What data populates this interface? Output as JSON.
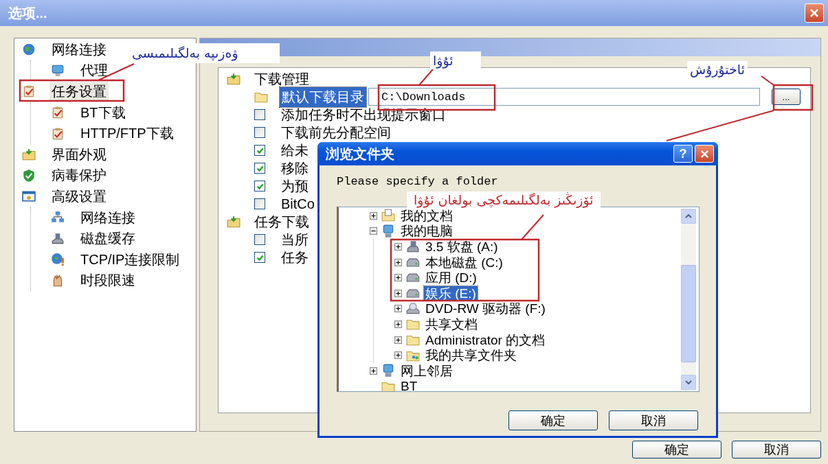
{
  "window": {
    "title": "选项..."
  },
  "sidebar": {
    "items": [
      {
        "label": "网络连接",
        "selected": false,
        "children": [
          {
            "label": "代理",
            "selected": false
          }
        ]
      },
      {
        "label": "任务设置",
        "selected": true,
        "children": [
          {
            "label": "BT下载",
            "selected": false
          },
          {
            "label": "HTTP/FTP下载",
            "selected": false
          }
        ]
      },
      {
        "label": "界面外观",
        "selected": false
      },
      {
        "label": "病毒保护",
        "selected": false
      },
      {
        "label": "高级设置",
        "selected": false,
        "children": [
          {
            "label": "网络连接",
            "selected": false
          },
          {
            "label": "磁盘缓存",
            "selected": false
          },
          {
            "label": "TCP/IP连接限制",
            "selected": false
          },
          {
            "label": "时段限速",
            "selected": false
          }
        ]
      }
    ]
  },
  "settings": {
    "groups": [
      {
        "title": "下载管理",
        "rows": [
          {
            "kind": "path",
            "label": "默认下载目录",
            "selected": true,
            "value": "C:\\Downloads",
            "button": "..."
          },
          {
            "kind": "checkbox",
            "label": "添加任务时不出现提示窗口",
            "checked": false
          },
          {
            "kind": "checkbox",
            "label": "下载前先分配空间",
            "checked": false
          },
          {
            "kind": "checkbox",
            "label": "给未",
            "checked": true
          },
          {
            "kind": "checkbox",
            "label": "移除",
            "checked": true
          },
          {
            "kind": "checkbox",
            "label": "为预",
            "checked": true
          },
          {
            "kind": "checkbox",
            "label": "BitCo",
            "checked": false
          }
        ]
      },
      {
        "title": "任务下载",
        "rows": [
          {
            "kind": "checkbox",
            "label": "当所",
            "checked": false
          },
          {
            "kind": "checkbox",
            "label": "任务",
            "checked": true
          }
        ]
      }
    ]
  },
  "buttons": [
    "确定",
    "取消"
  ],
  "dialog": {
    "title": "浏览文件夹",
    "help_button": "?",
    "prompt": "Please specify a folder",
    "tree": [
      {
        "label": "我的文档",
        "expanded": false,
        "selected": false
      },
      {
        "label": "我的电脑",
        "expanded": true,
        "selected": false,
        "children": [
          {
            "label": "3.5 软盘 (A:)",
            "expanded": false,
            "selected": false
          },
          {
            "label": "本地磁盘 (C:)",
            "expanded": false,
            "selected": false
          },
          {
            "label": "应用 (D:)",
            "expanded": false,
            "selected": false
          },
          {
            "label": "娱乐 (E:)",
            "expanded": false,
            "selected": true
          },
          {
            "label": "DVD-RW 驱动器 (F:)",
            "expanded": false,
            "selected": false
          },
          {
            "label": "共享文档",
            "expanded": false,
            "selected": false
          },
          {
            "label": "Administrator 的文档",
            "expanded": false,
            "selected": false
          },
          {
            "label": "我的共享文件夹",
            "expanded": false,
            "selected": false
          }
        ]
      },
      {
        "label": "网上邻居",
        "expanded": false,
        "selected": false
      },
      {
        "label": "BT",
        "selected": false
      }
    ],
    "buttons": [
      "确定",
      "取消"
    ]
  },
  "annotations": [
    {
      "text": "ۋەزىپە بەلگىلىمىسى",
      "color": "#1c2a9a"
    },
    {
      "text": "ئۇۋا",
      "color": "#1c2a9a"
    },
    {
      "text": "ئاختۇرۇش",
      "color": "#1c2a9a"
    },
    {
      "text": "ئۆزىڭىز بەلگىلىمەكچى بولغان ئۇۋا",
      "color": "#c0282c"
    }
  ]
}
